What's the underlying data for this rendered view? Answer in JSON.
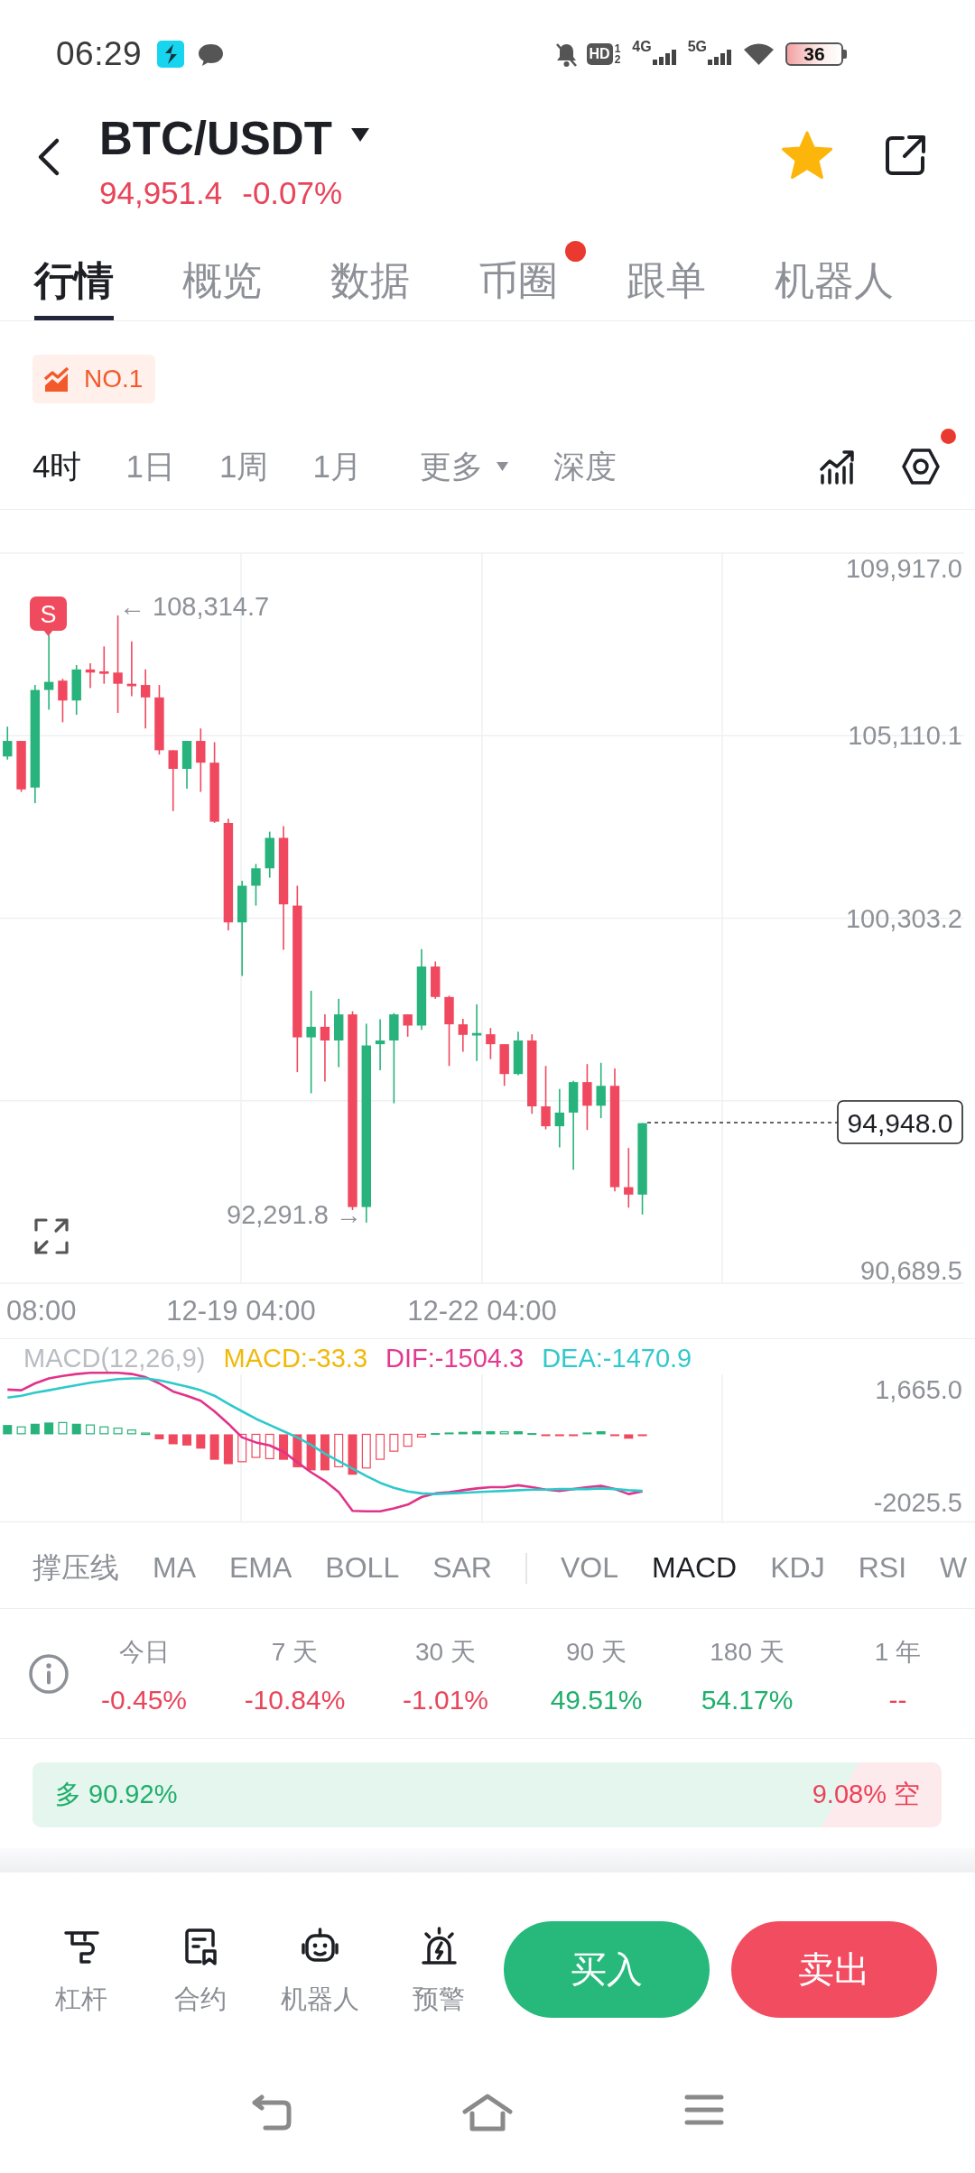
{
  "status_bar": {
    "time": "06:29",
    "hd": "HD",
    "sim_slots": [
      "1",
      "2"
    ],
    "networks": [
      "4G",
      "5G"
    ],
    "battery": "36"
  },
  "header": {
    "title": "BTC/USDT",
    "price": "94,951.4",
    "change": "-0.07%",
    "falling": true,
    "favorite": true
  },
  "tabs": [
    {
      "label": "行情",
      "selected": true,
      "dot": false
    },
    {
      "label": "概览",
      "selected": false,
      "dot": false
    },
    {
      "label": "数据",
      "selected": false,
      "dot": false
    },
    {
      "label": "币圈",
      "selected": false,
      "dot": true
    },
    {
      "label": "跟单",
      "selected": false,
      "dot": false
    },
    {
      "label": "机器人",
      "selected": false,
      "dot": false
    }
  ],
  "rank_badge": "NO.1",
  "periods": [
    {
      "label": "4时",
      "selected": true,
      "menu": false
    },
    {
      "label": "1日",
      "selected": false,
      "menu": false
    },
    {
      "label": "1周",
      "selected": false,
      "menu": false
    },
    {
      "label": "1月",
      "selected": false,
      "menu": false
    },
    {
      "label": "更多",
      "selected": false,
      "menu": true
    },
    {
      "label": "深度",
      "selected": false,
      "menu": false
    }
  ],
  "chart_tools": {
    "settings_dot": true
  },
  "price_chart": {
    "y_labels": [
      "109,917.0",
      "105,110.1",
      "100,303.2",
      "90,689.5"
    ],
    "x_labels": [
      "08:00",
      "12-19 04:00",
      "12-22 04:00"
    ],
    "high_label": "← 108,314.7",
    "low_label": "92,291.8 →",
    "last_price": "94,948.0",
    "signal": "S"
  },
  "macd": {
    "legend": [
      {
        "text": "MACD(12,26,9)",
        "color": "#b9bcc2"
      },
      {
        "text": "MACD:-33.3",
        "color": "#f0b90b"
      },
      {
        "text": "DIF:-1504.3",
        "color": "#e23a8f"
      },
      {
        "text": "DEA:-1470.9",
        "color": "#33c8cc"
      }
    ],
    "y_labels": [
      "1,665.0",
      "-2025.5"
    ]
  },
  "indicators": {
    "main": [
      {
        "label": "撑压线",
        "selected": false
      },
      {
        "label": "MA",
        "selected": false
      },
      {
        "label": "EMA",
        "selected": false
      },
      {
        "label": "BOLL",
        "selected": false
      },
      {
        "label": "SAR",
        "selected": false
      }
    ],
    "sub": [
      {
        "label": "VOL",
        "selected": false
      },
      {
        "label": "MACD",
        "selected": true
      },
      {
        "label": "KDJ",
        "selected": false
      },
      {
        "label": "RSI",
        "selected": false
      },
      {
        "label": "W",
        "selected": false
      }
    ]
  },
  "returns": [
    {
      "period": "今日",
      "value": "-0.45%",
      "falling": true
    },
    {
      "period": "7 天",
      "value": "-10.84%",
      "falling": true
    },
    {
      "period": "30 天",
      "value": "-1.01%",
      "falling": true
    },
    {
      "period": "90 天",
      "value": "49.51%",
      "falling": false
    },
    {
      "period": "180 天",
      "value": "54.17%",
      "falling": false
    },
    {
      "period": "1 年",
      "value": "--",
      "falling": true
    }
  ],
  "long_short": {
    "long_text": "多 90.92%",
    "short_text": "9.08% 空",
    "level": 0.9092
  },
  "tools": [
    {
      "label": "杠杆",
      "kind": "leverage"
    },
    {
      "label": "合约",
      "kind": "contract"
    },
    {
      "label": "机器人",
      "kind": "robot"
    },
    {
      "label": "预警",
      "kind": "alert"
    }
  ],
  "trade_buttons": [
    {
      "label": "买入",
      "kind": "buy"
    },
    {
      "label": "卖出",
      "kind": "sell"
    }
  ]
}
